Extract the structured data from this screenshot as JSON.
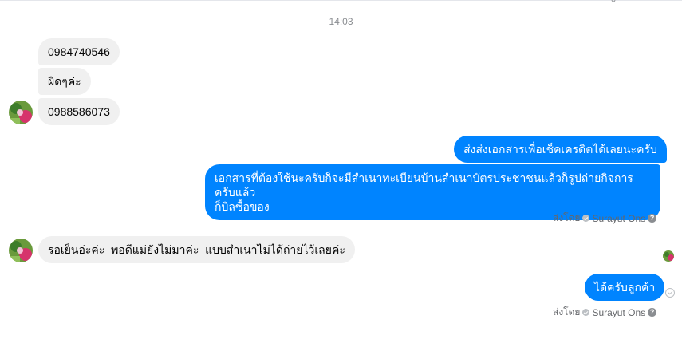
{
  "conversation": {
    "timestamp": "14:03",
    "incoming_group_1": [
      {
        "text": "0984740546"
      },
      {
        "text": "ผิดๆค่ะ"
      },
      {
        "text": "0988586073"
      }
    ],
    "outgoing_group_1": [
      {
        "text": "ส่งส่งเอกสารเพื่อเช็คเครดิตได้เลยนะครับ"
      },
      {
        "line1": "เอกสารที่ต้องใช้นะครับก็จะมีสำเนาทะเบียนบ้านสำเนาบัตรประชาชนแล้วก็รูปถ่ายกิจการครับแล้ว",
        "line2": "ก็บิลซื้อของ"
      }
    ],
    "sent_by_1": {
      "prefix": "ส่งโดย",
      "name": "Surayut Ons"
    },
    "incoming_group_2": [
      {
        "text": "รอเย็นอ่ะค่ะ  พอดีแม่ยังไม่มาค่ะ  แบบสำเนาไม่ได้ถ่ายไว้เลยค่ะ"
      }
    ],
    "outgoing_group_2": [
      {
        "text": "ได้ครับลูกค้า"
      }
    ],
    "sent_by_2": {
      "prefix": "ส่งโดย",
      "name": "Surayut Ons"
    }
  },
  "icons": {
    "contact_avatar": "avatar",
    "read_receipt": "avatar-mini",
    "sent_status": "check-circle-icon",
    "help": "question-icon",
    "delivered": "delivered-check-icon"
  },
  "colors": {
    "outgoing_bubble": "#0084ff",
    "incoming_bubble": "#f0f0f0",
    "meta_text": "#65676b",
    "timestamp_text": "#8a8d91"
  }
}
